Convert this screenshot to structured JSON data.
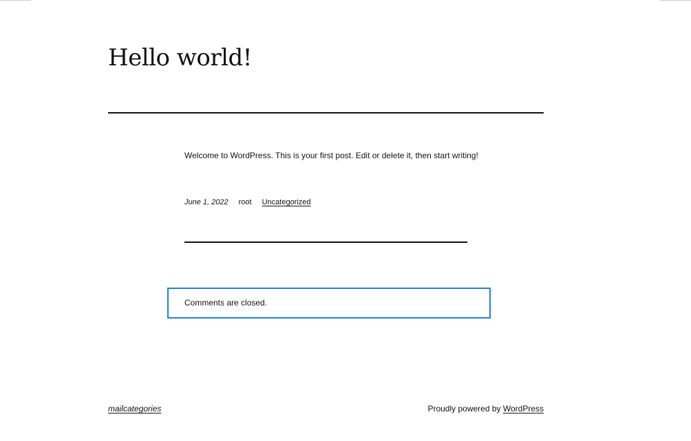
{
  "post": {
    "title": "Hello world!",
    "content": "Welcome to WordPress. This is your first post. Edit or delete it, then start writing!",
    "date": "June 1, 2022",
    "author": "root",
    "category": "Uncategorized"
  },
  "comments": {
    "status": "Comments are closed."
  },
  "footer": {
    "site_name": "mailcategories",
    "powered_prefix": "Proudly powered by ",
    "powered_link": "WordPress"
  },
  "colors": {
    "text": "#111111",
    "focus_outline": "#1a82e2",
    "background": "#ffffff"
  }
}
